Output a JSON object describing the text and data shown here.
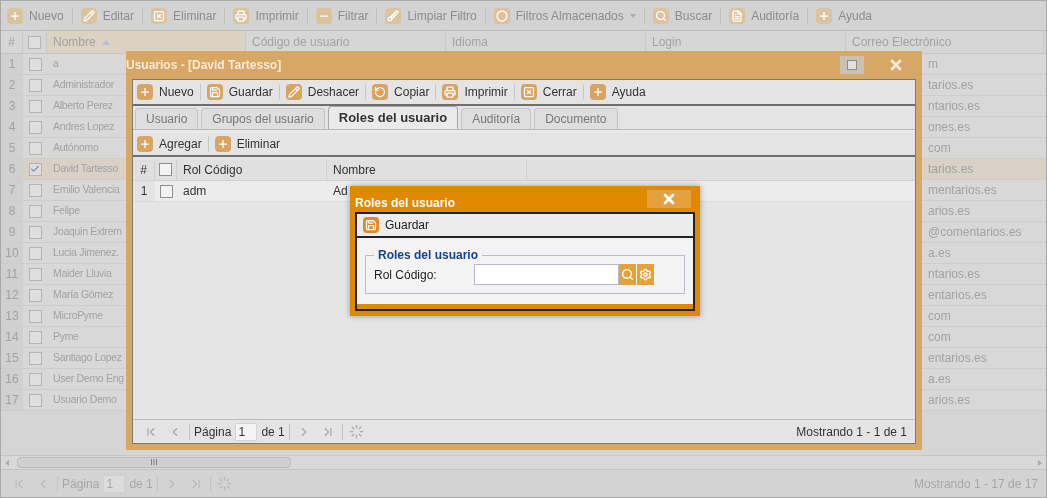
{
  "toolbar": [
    {
      "label": "Nuevo"
    },
    {
      "label": "Editar"
    },
    {
      "label": "Eliminar"
    },
    {
      "label": "Imprimir"
    },
    {
      "label": "Filtrar"
    },
    {
      "label": "Limpiar Filtro"
    },
    {
      "label": "Filtros Almacenados",
      "dropdown": true
    },
    {
      "label": "Buscar"
    },
    {
      "label": "Auditoría"
    },
    {
      "label": "Ayuda"
    }
  ],
  "grid": {
    "select_all": false,
    "columns": [
      {
        "label": "#"
      },
      {
        "label": "Nombre",
        "sorted": true
      },
      {
        "label": "Código de usuario"
      },
      {
        "label": "Idioma"
      },
      {
        "label": "Login"
      },
      {
        "label": "Correo Electrónico"
      }
    ],
    "rows": [
      {
        "number": "1",
        "checked": false,
        "selected": false,
        "name": "a",
        "email": "m"
      },
      {
        "number": "2",
        "checked": false,
        "selected": false,
        "name": "Administrador",
        "email": "tarios.es"
      },
      {
        "number": "3",
        "checked": false,
        "selected": false,
        "name": "Alberto Perez",
        "email": "ntarios.es"
      },
      {
        "number": "4",
        "checked": false,
        "selected": false,
        "name": "Andres Lopez",
        "email": "ones.es"
      },
      {
        "number": "5",
        "checked": false,
        "selected": false,
        "name": "Autónomo",
        "email": "com"
      },
      {
        "number": "6",
        "checked": true,
        "selected": true,
        "name": "David Tartesso",
        "email": "tarios.es"
      },
      {
        "number": "7",
        "checked": false,
        "selected": false,
        "name": "Emilio Valencia",
        "email": "mentarios.es"
      },
      {
        "number": "8",
        "checked": false,
        "selected": false,
        "name": "Felipe",
        "email": "arios.es"
      },
      {
        "number": "9",
        "checked": false,
        "selected": false,
        "name": "Joaquin Extrem",
        "email": "@comentarios.es"
      },
      {
        "number": "10",
        "checked": false,
        "selected": false,
        "name": "Lucia Jimenez.",
        "email": "a.es"
      },
      {
        "number": "11",
        "checked": false,
        "selected": false,
        "name": "Maider Lluvia",
        "email": "ntarios.es"
      },
      {
        "number": "12",
        "checked": false,
        "selected": false,
        "name": "María Gómez",
        "email": "entarios.es"
      },
      {
        "number": "13",
        "checked": false,
        "selected": false,
        "name": "MicroPyme",
        "email": "com"
      },
      {
        "number": "14",
        "checked": false,
        "selected": false,
        "name": "Pyme",
        "email": "com"
      },
      {
        "number": "15",
        "checked": false,
        "selected": false,
        "name": "Santiago Lopez",
        "email": "entarios.es"
      },
      {
        "number": "16",
        "checked": false,
        "selected": false,
        "name": "User Demo Eng",
        "email": "a.es"
      },
      {
        "number": "17",
        "checked": false,
        "selected": false,
        "name": "Usuario Demo",
        "email": "arios.es"
      }
    ],
    "scroll_grip": "III",
    "pager": {
      "page_label": "Página",
      "page": "1",
      "page_total": "de 1",
      "summary": "Mostrando 1 - 17 de 17"
    }
  },
  "window": {
    "title": "Usuarios - [David Tartesso]",
    "toolbar": [
      {
        "label": "Nuevo"
      },
      {
        "label": "Guardar"
      },
      {
        "label": "Deshacer"
      },
      {
        "label": "Copiar"
      },
      {
        "label": "Imprimir"
      },
      {
        "label": "Cerrar"
      },
      {
        "label": "Ayuda"
      }
    ],
    "tabs": [
      {
        "label": "Usuario",
        "selected": false
      },
      {
        "label": "Grupos del usuario",
        "selected": false
      },
      {
        "label": "Roles del usuario",
        "selected": true
      },
      {
        "label": "Auditoría",
        "selected": false
      },
      {
        "label": "Documento",
        "selected": false
      }
    ],
    "sub_toolbar": [
      {
        "label": "Agregar"
      },
      {
        "label": "Eliminar"
      }
    ],
    "select_all": false,
    "columns": [
      {
        "label": "#"
      },
      {
        "label": "Rol Código"
      },
      {
        "label": "Nombre"
      }
    ],
    "rows": [
      {
        "number": "1",
        "checked": false,
        "code": "adm",
        "name": "Ad"
      }
    ],
    "pager": {
      "page_label": "Página",
      "page": "1",
      "page_total": "de 1",
      "summary": "Mostrando 1 - 1 de 1"
    }
  },
  "dialog": {
    "title": "Roles del usuario",
    "toolbar": [
      {
        "label": "Guardar"
      }
    ],
    "legend": "Roles del usuario",
    "field_label": "Rol Código:"
  }
}
